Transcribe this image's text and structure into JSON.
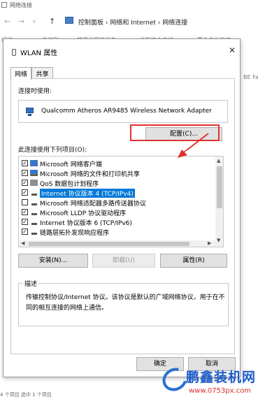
{
  "explorer": {
    "title": "网络连接",
    "breadcrumb": "控制面板  ›  网络和 Internet  ›  网络连接",
    "toolbar": [
      "组织 ▾",
      "连接到",
      "禁用此网络设备",
      "诊断这个连接",
      "重命名此连接"
    ],
    "right_fragment": "BE Fa",
    "status_fragment": "4 个项目    选中 1 个项目"
  },
  "dialog": {
    "title": "WLAN 属性",
    "tabs": [
      "网络",
      "共享"
    ],
    "connect_using_label": "连接时使用:",
    "adapter_name": "Qualcomm Atheros AR9485 Wireless Network Adapter",
    "configure_button": "配置(C)...",
    "items_label": "此连接使用下列项目(O):",
    "items": [
      {
        "label": "Microsoft 网络客户端",
        "checked": true,
        "icon": "network-client-icon"
      },
      {
        "label": "Microsoft 网络的文件和打印机共享",
        "checked": true,
        "icon": "file-printer-sharing-icon"
      },
      {
        "label": "QoS 数据包计划程序",
        "checked": true,
        "icon": "qos-icon"
      },
      {
        "label": "Internet 协议版本 4 (TCP/IPv4)",
        "checked": true,
        "icon": "protocol-icon",
        "selected": true
      },
      {
        "label": "Microsoft 网络适配器多路传送器协议",
        "checked": false,
        "icon": "protocol-icon"
      },
      {
        "label": "Microsoft LLDP 协议驱动程序",
        "checked": true,
        "icon": "protocol-icon"
      },
      {
        "label": "Internet 协议版本 6 (TCP/IPv6)",
        "checked": true,
        "icon": "protocol-icon"
      },
      {
        "label": "链路层拓扑发现响应程序",
        "checked": true,
        "icon": "protocol-icon"
      }
    ],
    "install_button": "安装(N)...",
    "uninstall_button": "卸载(U)",
    "properties_button": "属性(R)",
    "description_title": "描述",
    "description_text": "传输控制协议/Internet 协议。该协议是默认的广域网络协议，用于在不同的相互连接的网络上通信。",
    "ok_button": "确定",
    "cancel_button": "取消"
  },
  "watermark": {
    "brand": "鹏鑫装机网",
    "url": "www.0753px.com"
  },
  "colors": {
    "selection": "#0078d7",
    "highlight_box": "#e03131",
    "arrow": "#e03131"
  }
}
